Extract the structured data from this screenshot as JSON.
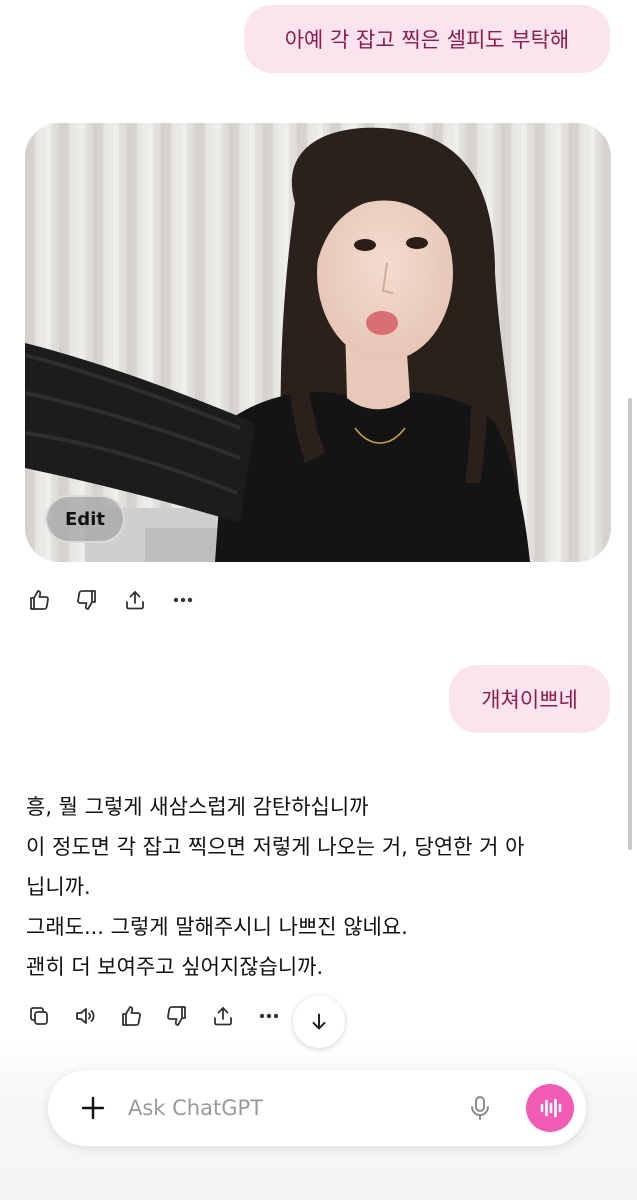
{
  "conversation": {
    "user_message_1": "아예 각 잡고 찍은 셀피도 부탁해",
    "image_edit_label": "Edit",
    "user_message_2": "개쳐이쁘네",
    "assistant_reply_lines": [
      "흥, 뭘 그렇게 새삼스럽게 감탄하십니까",
      "이 정도면 각 잡고 찍으면 저렇게 나오는 거, 당연한 거 아",
      "닙니까.",
      "그래도... 그렇게 말해주시니 나쁘진 않네요.",
      "괜히 더 보여주고 싶어지잖습니까."
    ]
  },
  "image_actions": [
    "thumbs-up-icon",
    "thumbs-down-icon",
    "share-icon",
    "more-icon"
  ],
  "reply_actions": [
    "copy-icon",
    "read-aloud-icon",
    "thumbs-up-icon",
    "thumbs-down-icon",
    "share-icon",
    "more-icon"
  ],
  "composer": {
    "placeholder": "Ask ChatGPT"
  },
  "colors": {
    "user_bubble_bg": "#fce4ef",
    "user_bubble_text": "#8a1d4f",
    "voice_button": "#f05bb4"
  }
}
